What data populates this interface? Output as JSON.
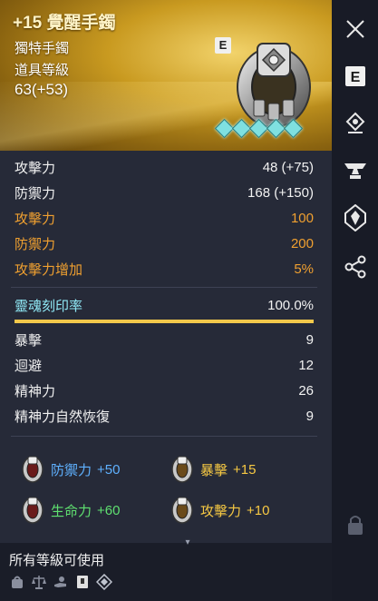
{
  "item": {
    "name": "+15 覺醒手鐲",
    "type": "獨特手鐲",
    "level_label": "道具等級",
    "level_value": "63(+53)",
    "grade_badge": "E",
    "gem_count": 5
  },
  "stats": [
    {
      "label": "攻擊力",
      "value": "48 (+75)",
      "color": "white"
    },
    {
      "label": "防禦力",
      "value": "168 (+150)",
      "color": "white"
    },
    {
      "label": "攻擊力",
      "value": "100",
      "color": "orange"
    },
    {
      "label": "防禦力",
      "value": "200",
      "color": "orange"
    },
    {
      "label": "攻擊力增加",
      "value": "5%",
      "color": "orange"
    }
  ],
  "soul": {
    "label": "靈魂刻印率",
    "value": "100.0%",
    "fill_fraction": 1.0,
    "bar_color": "#f2c84b"
  },
  "substats": [
    {
      "label": "暴擊",
      "value": "9"
    },
    {
      "label": "迴避",
      "value": "12"
    },
    {
      "label": "精神力",
      "value": "26"
    },
    {
      "label": "精神力自然恢復",
      "value": "9"
    }
  ],
  "bonuses": [
    {
      "label": "防禦力",
      "value": "+50",
      "color": "blue"
    },
    {
      "label": "暴擊",
      "value": "+15",
      "color": "gold"
    },
    {
      "label": "生命力",
      "value": "+60",
      "color": "green"
    },
    {
      "label": "攻擊力",
      "value": "+10",
      "color": "gold"
    }
  ],
  "footer": {
    "usable_text": "所有等級可使用",
    "icons": [
      "bag-icon",
      "scale-icon",
      "hand-icon",
      "book-icon",
      "diamond-icon"
    ]
  },
  "sidebar": {
    "buttons": [
      "close-icon",
      "equip-e-icon",
      "socket-icon",
      "anvil-icon",
      "awaken-icon",
      "share-icon",
      "lock-icon"
    ]
  },
  "colors": {
    "orange": "#f0a030",
    "cyan": "#8fe8f5",
    "blue": "#5fb1ff",
    "green": "#5fe070",
    "gold": "#f7c943"
  }
}
